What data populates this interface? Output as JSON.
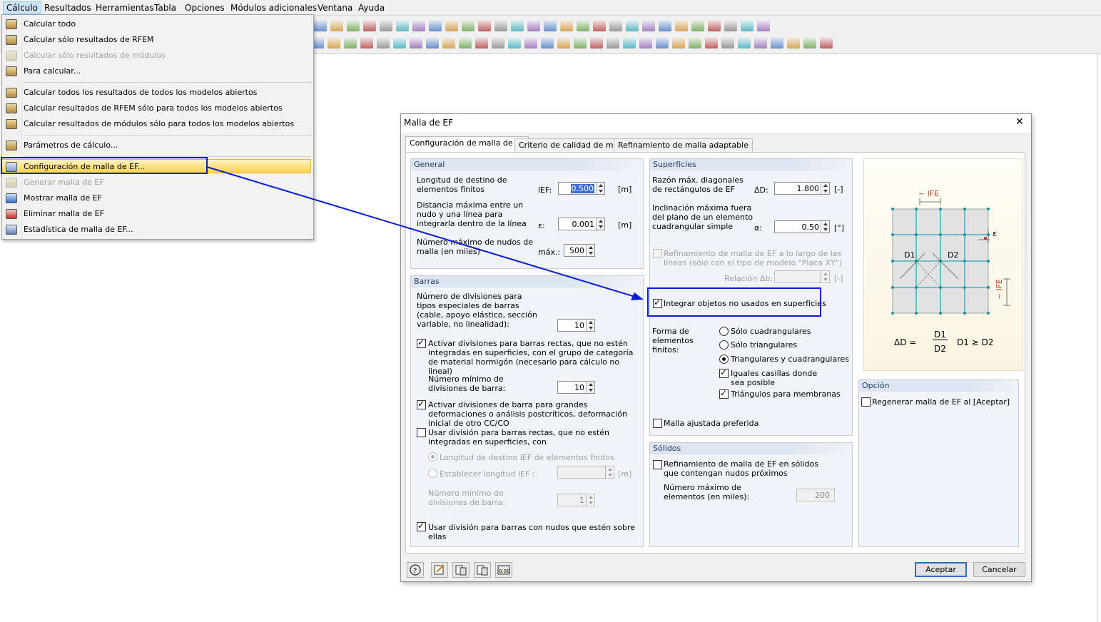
{
  "menubar": {
    "items": [
      "Cálculo",
      "Resultados",
      "Herramientas",
      "Tabla",
      "Opciones",
      "Módulos adicionales",
      "Ventana",
      "Ayuda"
    ]
  },
  "menu": {
    "items": [
      {
        "label": "Calcular todo",
        "enabled": true
      },
      {
        "label": "Calcular sólo resultados de RFEM",
        "enabled": true
      },
      {
        "label": "Calcular sólo resultados de módulos",
        "enabled": false
      },
      {
        "label": "Para calcular...",
        "enabled": true
      },
      {
        "label": "Calcular todos los resultados de todos los modelos abiertos",
        "enabled": true
      },
      {
        "label": "Calcular resultados de RFEM sólo para todos los modelos abiertos",
        "enabled": true
      },
      {
        "label": "Calcular resultados de módulos sólo para todos los modelos abiertos",
        "enabled": true
      },
      {
        "label": "Parámetros de cálculo...",
        "enabled": true
      },
      {
        "label": "Configuración de malla de EF...",
        "enabled": true,
        "highlighted": true
      },
      {
        "label": "Generar malla de EF",
        "enabled": false
      },
      {
        "label": "Mostrar malla de EF",
        "enabled": true
      },
      {
        "label": "Eliminar malla de EF",
        "enabled": true
      },
      {
        "label": "Estadística de malla de EF...",
        "enabled": true
      }
    ]
  },
  "dialog": {
    "title": "Malla de EF",
    "close": "✕",
    "tabs": [
      "Configuración de malla de EF",
      "Criterio de calidad de malla",
      "Refinamiento de malla adaptable"
    ],
    "general": {
      "header": "General",
      "target_length_label": "Longitud de destino de elementos finitos",
      "target_length_sym": "lEF:",
      "target_length_value": "0.500",
      "target_length_unit": "[m]",
      "max_distance_label": "Distancia máxima entre un nudo y una línea para integrarla dentro de la línea",
      "max_distance_sym": "ε:",
      "max_distance_value": "0.001",
      "max_distance_unit": "[m]",
      "max_nodes_label": "Número máximo de nudos de malla (en miles)",
      "max_nodes_sym": "máx.:",
      "max_nodes_value": "500"
    },
    "members": {
      "header": "Barras",
      "special_div_label": "Número de divisiones para tipos especiales de barras (cable, apoyo elástico, sección variable, no linealidad):",
      "special_div_value": "10",
      "activate_straight_label": "Activar divisiones para barras rectas, que no estén integradas en superficies, con el grupo de categoría de material hormigón (necesario para cálculo no lineal)",
      "min_div_label": "Número mínimo de divisiones de barra:",
      "min_div_value": "10",
      "activate_large_def_label": "Activar divisiones de barra para grandes deformaciones o análisis postcríticos, deformación inicial de otro CC/CO",
      "use_div_straight_label": "Usar división para barras rectas, que no estén integradas en superficies, con",
      "radio_target_length": "Longitud de destino lEF de elementos finitos",
      "radio_set_length": "Establecer longitud lEF :",
      "set_length_unit": "[m]",
      "min_div2_label": "Número mínimo de divisiones de barra:",
      "min_div2_value": "1",
      "use_div_nodes_label": "Usar división para barras con nudos que estén sobre ellas"
    },
    "surfaces": {
      "header": "Superficies",
      "ratio_label": "Razón máx. diagonales de rectángulos de EF",
      "ratio_sym": "ΔD:",
      "ratio_value": "1.800",
      "ratio_unit": "[-]",
      "incl_label": "Inclinación máxima fuera del plano de un elemento cuadrangular simple",
      "incl_sym": "α:",
      "incl_value": "0.50",
      "incl_unit": "[°]",
      "refine_lines_label": "Refinamiento de malla de EF a lo largo de las líneas (sólo con el tipo de modelo \"Placa XY\")",
      "relation_label": "Relación Δb:",
      "relation_unit": "[-]",
      "integrate_label": "Integrar objetos no usados en superficies",
      "shape_label": "Forma de elementos finitos:",
      "radio_quads": "Sólo cuadrangulares",
      "radio_tris": "Sólo triangulares",
      "radio_both": "Triangulares y cuadrangulares",
      "equal_cells_label": "Iguales casillas donde sea posible",
      "membrane_label": "Triángulos para membranas",
      "preferred_mesh_label": "Malla ajustada preferida"
    },
    "solids": {
      "header": "Sólidos",
      "refine_label": "Refinamiento de malla de EF en sólidos que contengan nudos próximos",
      "max_elements_label": "Número máximo de elementos (en miles):",
      "max_elements_value": "200"
    },
    "illustration": {
      "lfe_top": "~ lFE",
      "eps": "ε",
      "d1": "D1",
      "d2": "D2",
      "lfe_side": "~ lFE",
      "formula_lhs": "ΔD =",
      "formula_num": "D1",
      "formula_den": "D2",
      "formula_rhs": "D1 ≥ D2"
    },
    "option": {
      "header": "Opción",
      "regen_label": "Regenerar malla de EF al [Aceptar]"
    },
    "buttons": {
      "ok": "Aceptar",
      "cancel": "Cancelar"
    },
    "colors": {
      "accent": "#0a1ccf",
      "highlight": "#ffd24d",
      "mesh_line": "#2aa7b8"
    }
  }
}
